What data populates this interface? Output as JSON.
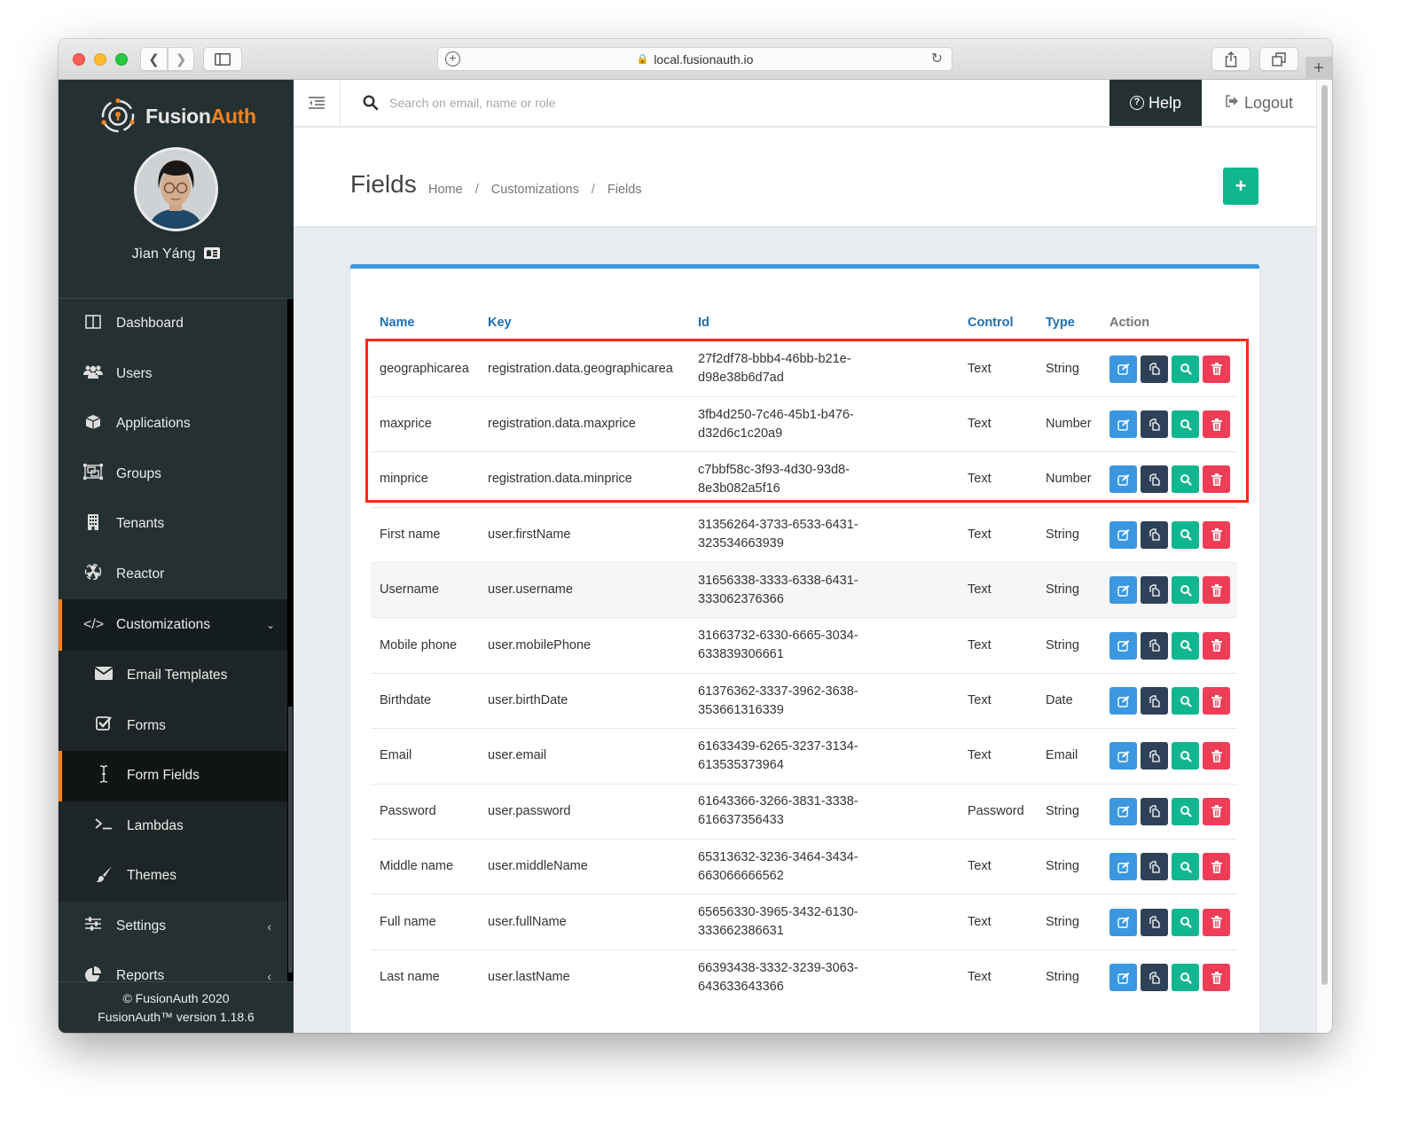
{
  "browser": {
    "url": "local.fusionauth.io"
  },
  "brand": {
    "name_part1": "Fusion",
    "name_part2": "Auth",
    "accent": "#f58320"
  },
  "user": {
    "name": "Jìan Yáng"
  },
  "sidebar": {
    "items": [
      {
        "label": "Dashboard",
        "icon": "dashboard-icon"
      },
      {
        "label": "Users",
        "icon": "users-icon"
      },
      {
        "label": "Applications",
        "icon": "cube-icon"
      },
      {
        "label": "Groups",
        "icon": "groups-icon"
      },
      {
        "label": "Tenants",
        "icon": "building-icon"
      },
      {
        "label": "Reactor",
        "icon": "reactor-icon"
      }
    ],
    "customizations": {
      "label": "Customizations",
      "expanded": true,
      "children": [
        {
          "label": "Email Templates",
          "icon": "envelope-icon"
        },
        {
          "label": "Forms",
          "icon": "checkbox-icon"
        },
        {
          "label": "Form Fields",
          "icon": "text-cursor-icon",
          "active": true
        },
        {
          "label": "Lambdas",
          "icon": "terminal-icon"
        },
        {
          "label": "Themes",
          "icon": "brush-icon"
        }
      ]
    },
    "settings": {
      "label": "Settings"
    },
    "reports": {
      "label": "Reports"
    },
    "footer": {
      "copyright": "© FusionAuth 2020",
      "version": "FusionAuth™ version 1.18.6"
    }
  },
  "topbar": {
    "search_placeholder": "Search on email, name or role",
    "help_label": "Help",
    "logout_label": "Logout"
  },
  "page": {
    "title": "Fields",
    "breadcrumb": [
      "Home",
      "Customizations",
      "Fields"
    ],
    "add_button": "+"
  },
  "table": {
    "columns": [
      "Name",
      "Key",
      "Id",
      "Control",
      "Type",
      "Action"
    ],
    "rows": [
      {
        "name": "geographicarea",
        "key": "registration.data.geographicarea",
        "id1": "27f2df78-bbb4-46bb-b21e-",
        "id2": "d98e38b6d7ad",
        "control": "Text",
        "type": "String",
        "highlighted": true
      },
      {
        "name": "maxprice",
        "key": "registration.data.maxprice",
        "id1": "3fb4d250-7c46-45b1-b476-",
        "id2": "d32d6c1c20a9",
        "control": "Text",
        "type": "Number",
        "highlighted": true
      },
      {
        "name": "minprice",
        "key": "registration.data.minprice",
        "id1": "c7bbf58c-3f93-4d30-93d8-",
        "id2": "8e3b082a5f16",
        "control": "Text",
        "type": "Number",
        "highlighted": true
      },
      {
        "name": "First name",
        "key": "user.firstName",
        "id1": "31356264-3733-6533-6431-",
        "id2": "323534663939",
        "control": "Text",
        "type": "String"
      },
      {
        "name": "Username",
        "key": "user.username",
        "id1": "31656338-3333-6338-6431-",
        "id2": "333062376366",
        "control": "Text",
        "type": "String",
        "hovered": true
      },
      {
        "name": "Mobile phone",
        "key": "user.mobilePhone",
        "id1": "31663732-6330-6665-3034-",
        "id2": "633839306661",
        "control": "Text",
        "type": "String"
      },
      {
        "name": "Birthdate",
        "key": "user.birthDate",
        "id1": "61376362-3337-3962-3638-",
        "id2": "353661316339",
        "control": "Text",
        "type": "Date"
      },
      {
        "name": "Email",
        "key": "user.email",
        "id1": "61633439-6265-3237-3134-",
        "id2": "613535373964",
        "control": "Text",
        "type": "Email"
      },
      {
        "name": "Password",
        "key": "user.password",
        "id1": "61643366-3266-3831-3338-",
        "id2": "616637356433",
        "control": "Password",
        "type": "String"
      },
      {
        "name": "Middle name",
        "key": "user.middleName",
        "id1": "65313632-3236-3464-3434-",
        "id2": "663066666562",
        "control": "Text",
        "type": "String"
      },
      {
        "name": "Full name",
        "key": "user.fullName",
        "id1": "65656330-3965-3432-6130-",
        "id2": "333662386631",
        "control": "Text",
        "type": "String"
      },
      {
        "name": "Last name",
        "key": "user.lastName",
        "id1": "66393438-3332-3239-3063-",
        "id2": "643633643366",
        "control": "Text",
        "type": "String"
      }
    ],
    "action_buttons": [
      "edit",
      "duplicate",
      "view",
      "delete"
    ]
  },
  "colors": {
    "edit": "#3b97df",
    "duplicate": "#2f4158",
    "view": "#10b68f",
    "delete": "#ee3d56",
    "highlight_box": "#ff2a10",
    "panel_top": "#3c97e0"
  }
}
